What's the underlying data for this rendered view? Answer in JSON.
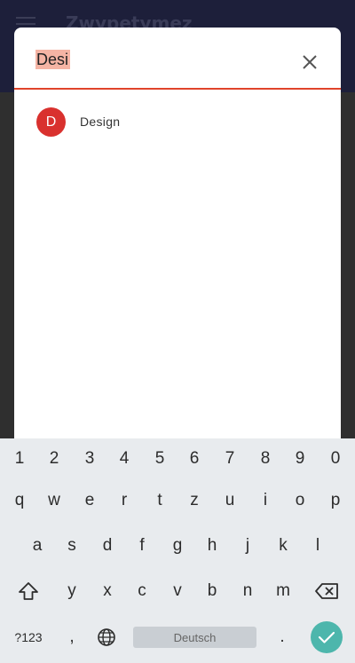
{
  "background_app": {
    "title": "Zwypetymez"
  },
  "search": {
    "query": "Desi"
  },
  "results": [
    {
      "avatar_letter": "D",
      "label": "Design"
    }
  ],
  "keyboard": {
    "numbers": [
      "1",
      "2",
      "3",
      "4",
      "5",
      "6",
      "7",
      "8",
      "9",
      "0"
    ],
    "row1": [
      "q",
      "w",
      "e",
      "r",
      "t",
      "z",
      "u",
      "i",
      "o",
      "p"
    ],
    "row2": [
      "a",
      "s",
      "d",
      "f",
      "g",
      "h",
      "j",
      "k",
      "l"
    ],
    "row3": [
      "y",
      "x",
      "c",
      "v",
      "b",
      "n",
      "m"
    ],
    "symbols_label": "?123",
    "comma": ",",
    "period": ".",
    "space_label": "Deutsch"
  },
  "colors": {
    "accent": "#e0442b",
    "selection": "#f5b4a4",
    "avatar": "#d9312e",
    "enter": "#4db6ac"
  },
  "icons": [
    "menu-icon",
    "close-icon",
    "shift-icon",
    "backspace-icon",
    "globe-icon",
    "check-icon"
  ]
}
